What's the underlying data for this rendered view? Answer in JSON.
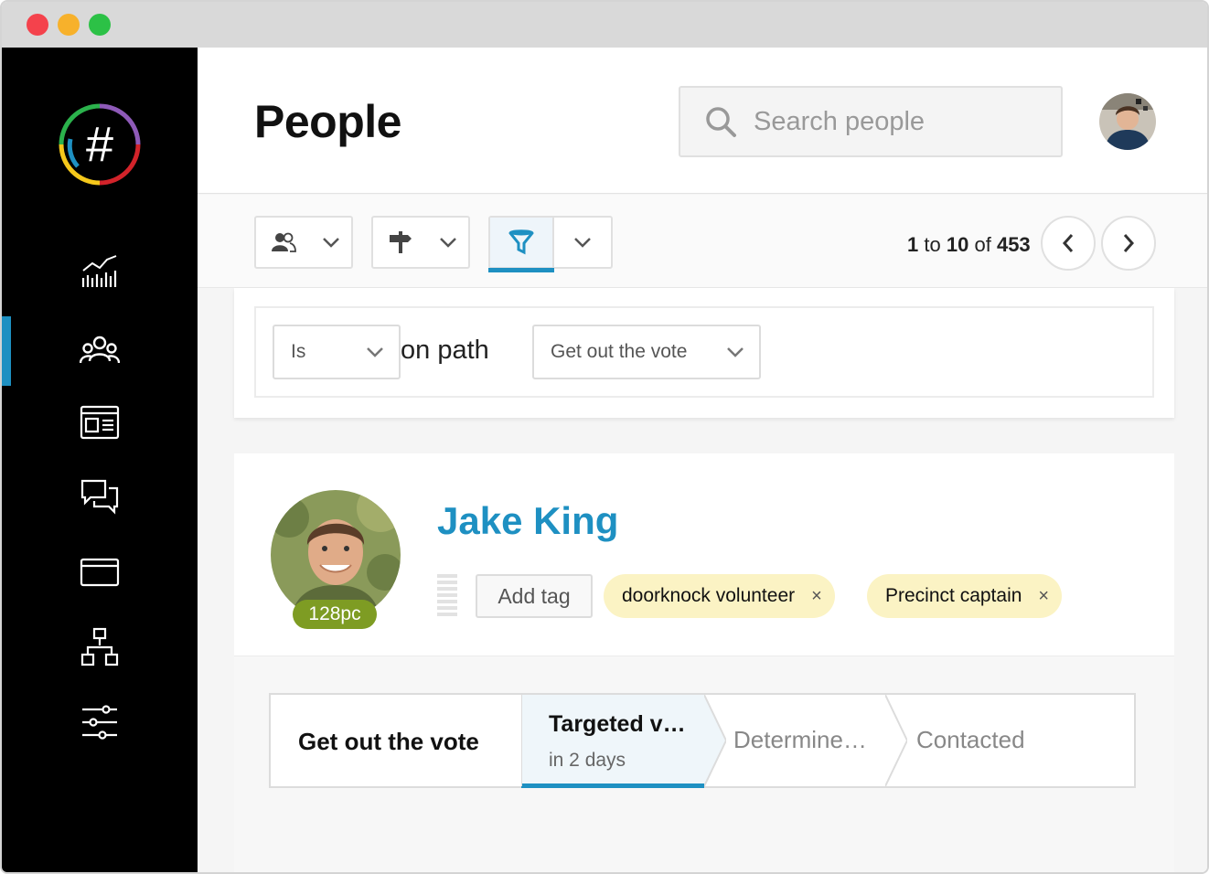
{
  "window": {
    "controls": [
      "close",
      "minimize",
      "zoom"
    ]
  },
  "sidebar": {
    "logo_text": "#",
    "items": [
      {
        "name": "dashboard",
        "icon": "chart-icon",
        "active": false
      },
      {
        "name": "people",
        "icon": "people-icon",
        "active": true
      },
      {
        "name": "website",
        "icon": "news-icon",
        "active": false
      },
      {
        "name": "communications",
        "icon": "chat-icon",
        "active": false
      },
      {
        "name": "finances",
        "icon": "card-icon",
        "active": false
      },
      {
        "name": "organization",
        "icon": "org-chart-icon",
        "active": false
      },
      {
        "name": "settings",
        "icon": "sliders-icon",
        "active": false
      }
    ]
  },
  "header": {
    "title": "People",
    "search_placeholder": "Search people"
  },
  "toolbar": {
    "pager": {
      "start": "1",
      "to": "to",
      "end": "10",
      "of": "of",
      "total": "453"
    }
  },
  "filter": {
    "condition": "Is",
    "label": "on path",
    "path": "Get out the vote"
  },
  "person": {
    "name": "Jake King",
    "score": "128pc",
    "add_tag_label": "Add tag",
    "tags": [
      "doorknock volunteer",
      "Precinct captain"
    ],
    "tag_remove_glyph": "×"
  },
  "path": {
    "name": "Get out the vote",
    "current_step": {
      "title": "Targeted v…",
      "due": "in 2 days"
    },
    "steps": [
      "Determine…",
      "Contacted"
    ]
  },
  "colors": {
    "accent": "#1e90c2",
    "score_badge": "#7e9c23",
    "tag_bg": "#fbf3c4",
    "sidebar_bg": "#000000"
  }
}
